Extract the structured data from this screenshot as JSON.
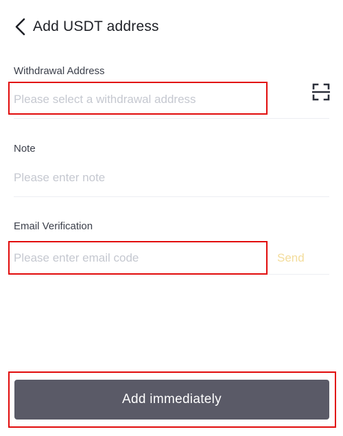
{
  "header": {
    "back_icon": "chevron-left-icon",
    "title": "Add USDT address"
  },
  "withdrawal_address": {
    "label": "Withdrawal Address",
    "placeholder": "Please select a withdrawal address",
    "value": "",
    "scan_icon": "scan-qr-icon"
  },
  "note": {
    "label": "Note",
    "placeholder": "Please enter note",
    "value": ""
  },
  "email_verification": {
    "label": "Email Verification",
    "placeholder": "Please enter email code",
    "value": "",
    "send_label": "Send"
  },
  "submit": {
    "label": "Add immediately"
  },
  "colors": {
    "highlight": "#e10a0a",
    "button_bg": "#5a5a67",
    "send_text": "#f3dc9a",
    "placeholder": "#c5c8d0"
  }
}
